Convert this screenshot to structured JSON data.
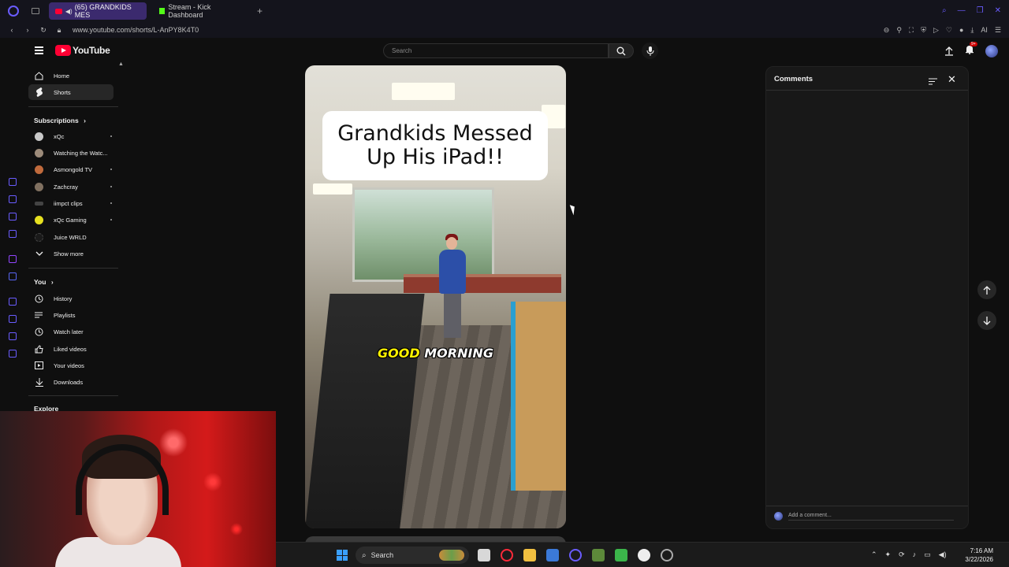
{
  "browser": {
    "tabs": [
      {
        "label": "(65) GRANDKIDS MES",
        "active": true
      },
      {
        "label": "Stream - Kick Dashboard",
        "active": false
      }
    ],
    "url": "www.youtube.com/shorts/L-AnPY8K4T0",
    "accent_color": "#6a5cff"
  },
  "header": {
    "logo_text": "YouTube",
    "search_placeholder": "Search",
    "notification_count": "9+"
  },
  "sidebar": {
    "main": [
      {
        "label": "Home",
        "icon": "home-icon"
      },
      {
        "label": "Shorts",
        "icon": "shorts-icon",
        "active": true
      }
    ],
    "subscriptions_title": "Subscriptions",
    "subscriptions": [
      {
        "label": "xQc"
      },
      {
        "label": "Watching the Watc..."
      },
      {
        "label": "Asmongold TV"
      },
      {
        "label": "Zachcray"
      },
      {
        "label": "iimpct clips"
      },
      {
        "label": "xQc Gaming"
      },
      {
        "label": "Juice WRLD"
      }
    ],
    "show_more": "Show more",
    "you_title": "You",
    "you_items": [
      {
        "label": "History",
        "icon": "history-icon"
      },
      {
        "label": "Playlists",
        "icon": "playlists-icon"
      },
      {
        "label": "Watch later",
        "icon": "watch-later-icon"
      },
      {
        "label": "Liked videos",
        "icon": "thumbs-up-icon"
      },
      {
        "label": "Your videos",
        "icon": "your-videos-icon"
      },
      {
        "label": "Downloads",
        "icon": "download-icon"
      }
    ],
    "explore_title": "Explore"
  },
  "short": {
    "caption": "Grandkids Messed Up His iPad!!",
    "subtitle_highlight": "GOOD",
    "subtitle_rest": "MORNING"
  },
  "comments": {
    "title": "Comments",
    "add_placeholder": "Add a comment..."
  },
  "taskbar": {
    "search_label": "Search",
    "time": "7:16 AM",
    "date": "3/22/2026"
  }
}
